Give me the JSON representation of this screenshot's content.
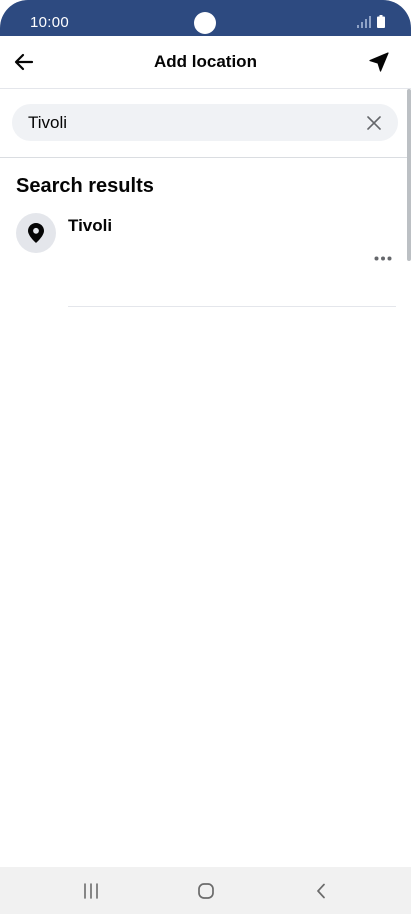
{
  "status_bar": {
    "time": "10:00",
    "icons": [
      "signal-icon",
      "battery-icon"
    ]
  },
  "header": {
    "title": "Add location",
    "back_icon": "arrow-left-icon",
    "location_icon": "navigation-arrow-icon"
  },
  "search": {
    "value": "Tivoli",
    "placeholder": "",
    "clear_icon": "close-icon"
  },
  "results": {
    "heading": "Search results",
    "items": [
      {
        "name": "Tivoli",
        "icon": "location-pin-icon",
        "more_icon": "more-horizontal-icon"
      }
    ]
  },
  "nav_bar": {
    "buttons": [
      "recents-icon",
      "home-icon",
      "back-icon"
    ]
  },
  "colors": {
    "status_bar": "#2d4a80",
    "text": "#050505",
    "search_background": "#f0f2f5",
    "divider": "#e4e6eb",
    "nav_bar": "#f1f1f1"
  }
}
